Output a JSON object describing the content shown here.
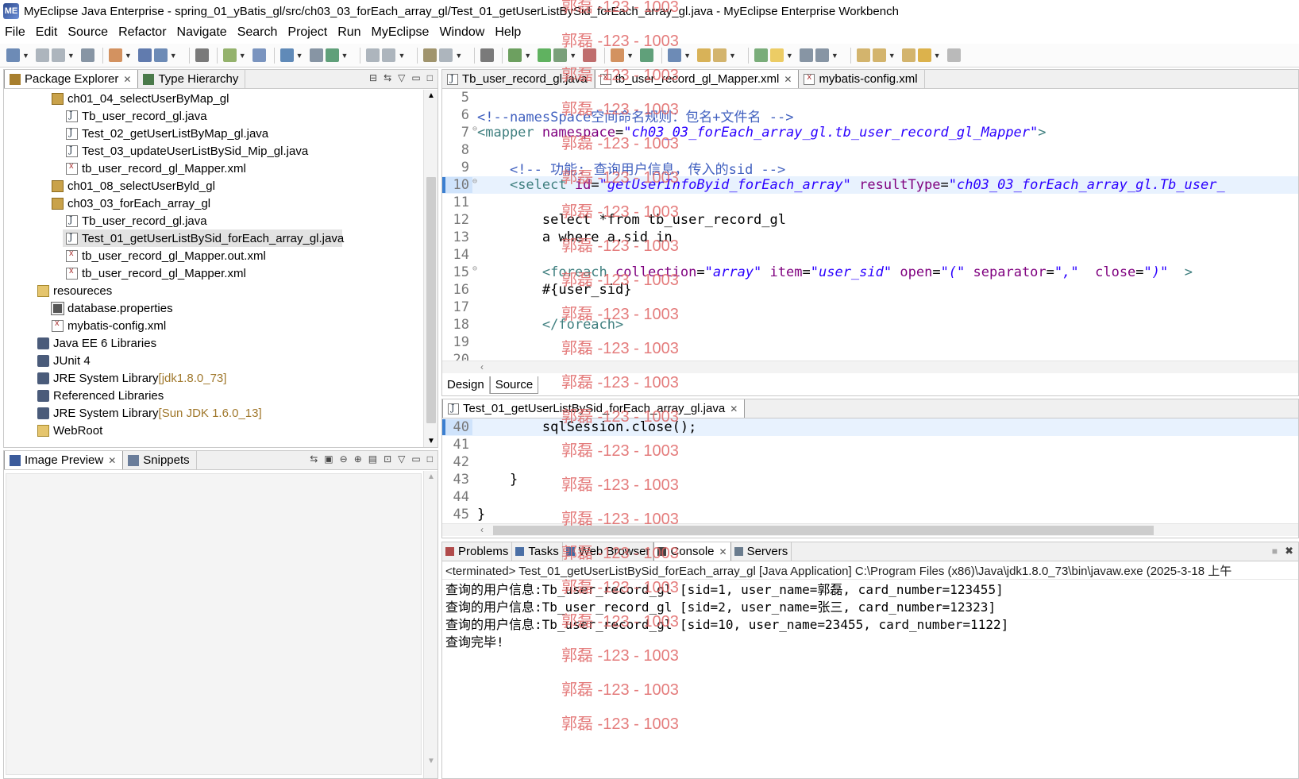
{
  "window": {
    "title": "MyEclipse Java Enterprise - spring_01_yBatis_gl/src/ch03_03_forEach_array_gl/Test_01_getUserListBySid_forEach_array_gl.java - MyEclipse Enterprise Workbench"
  },
  "menu": [
    "File",
    "Edit",
    "Source",
    "Refactor",
    "Navigate",
    "Search",
    "Project",
    "Run",
    "MyEclipse",
    "Window",
    "Help"
  ],
  "package_explorer": {
    "tabs": [
      "Package Explorer",
      "Type Hierarchy"
    ],
    "items": [
      {
        "label": "ch01_04_selectUserByMap_gl",
        "type": "pkg",
        "indent": 3
      },
      {
        "label": "Tb_user_record_gl.java",
        "type": "java",
        "indent": 4
      },
      {
        "label": "Test_02_getUserListByMap_gl.java",
        "type": "java",
        "indent": 4
      },
      {
        "label": "Test_03_updateUserListBySid_Mip_gl.java",
        "type": "java",
        "indent": 4
      },
      {
        "label": "tb_user_record_gl_Mapper.xml",
        "type": "xml",
        "indent": 4
      },
      {
        "label": "ch01_08_selectUserByld_gl",
        "type": "pkg",
        "indent": 3
      },
      {
        "label": "ch03_03_forEach_array_gl",
        "type": "pkg",
        "indent": 3
      },
      {
        "label": "Tb_user_record_gl.java",
        "type": "java",
        "indent": 4
      },
      {
        "label": "Test_01_getUserListBySid_forEach_array_gl.java",
        "type": "java",
        "indent": 4,
        "selected": true
      },
      {
        "label": "tb_user_record_gl_Mapper.out.xml",
        "type": "xml",
        "indent": 4
      },
      {
        "label": "tb_user_record_gl_Mapper.xml",
        "type": "xml",
        "indent": 4
      },
      {
        "label": "resoureces",
        "type": "folder",
        "indent": 2
      },
      {
        "label": "database.properties",
        "type": "props",
        "indent": 3
      },
      {
        "label": "mybatis-config.xml",
        "type": "xml",
        "indent": 3
      },
      {
        "label": "Java EE 6 Libraries",
        "type": "lib",
        "indent": 2
      },
      {
        "label": "JUnit 4",
        "type": "lib",
        "indent": 2
      },
      {
        "label": "JRE System Library",
        "suffix": "[jdk1.8.0_73]",
        "type": "lib",
        "indent": 2
      },
      {
        "label": "Referenced Libraries",
        "type": "lib",
        "indent": 2
      },
      {
        "label": "JRE System Library",
        "suffix": "[Sun JDK 1.6.0_13]",
        "type": "lib",
        "indent": 2
      },
      {
        "label": "WebRoot",
        "type": "folder",
        "indent": 2
      }
    ]
  },
  "image_preview": {
    "tabs": [
      "Image Preview",
      "Snippets"
    ]
  },
  "xml_editor": {
    "tabs": [
      "Tb_user_record_gl.java",
      "tb_user_record_gl_Mapper.xml",
      "mybatis-config.xml"
    ],
    "active_tab": 1,
    "bottom_tabs": [
      "Design",
      "Source"
    ],
    "lines": [
      {
        "n": "5",
        "html": ""
      },
      {
        "n": "6",
        "html": "<span class='cmt'>&lt;!--namesSpace空间命名规则：包名+文件名 --&gt;</span>"
      },
      {
        "n": "7",
        "fold": true,
        "html": "<span class='tag'>&lt;mapper</span> <span class='attr'>namespace</span>=<span class='str'>\"ch03_03_forEach_array_gl.tb_user_record_gl_Mapper\"</span><span class='tag'>&gt;</span>"
      },
      {
        "n": "8",
        "html": ""
      },
      {
        "n": "9",
        "html": "    <span class='cmt'>&lt;!-- 功能: 查询用户信息，传入的sid --&gt;</span>"
      },
      {
        "n": "10",
        "fold": true,
        "cur": true,
        "html": "    <span class='tag'>&lt;select</span> <span class='attr'>id</span>=<span class='str'>\"getUserInfoByid_forEach_array\"</span> <span class='attr'>resultType</span>=<span class='str'>\"ch03_03_forEach_array_gl.Tb_user_</span>"
      },
      {
        "n": "11",
        "html": ""
      },
      {
        "n": "12",
        "html": "        select *from tb_user_record_gl"
      },
      {
        "n": "13",
        "html": "        a where a.sid in"
      },
      {
        "n": "14",
        "html": ""
      },
      {
        "n": "15",
        "fold": true,
        "html": "        <span class='tag'>&lt;foreach</span> <span class='attr'>collection</span>=<span class='str'>\"array\"</span> <span class='attr'>item</span>=<span class='str'>\"user_sid\"</span> <span class='attr'>open</span>=<span class='str'>\"(\"</span> <span class='attr'>separator</span>=<span class='str'>\",\"</span>  <span class='attr'>close</span>=<span class='str'>\")\"</span>  <span class='tag'>&gt;</span>"
      },
      {
        "n": "16",
        "html": "        #{user_sid}"
      },
      {
        "n": "17",
        "html": ""
      },
      {
        "n": "18",
        "html": "        <span class='tag'>&lt;/foreach&gt;</span>"
      },
      {
        "n": "19",
        "html": ""
      },
      {
        "n": "20",
        "html": ""
      }
    ]
  },
  "java_editor": {
    "tab": "Test_01_getUserListBySid_forEach_array_gl.java",
    "lines": [
      {
        "n": "40",
        "cur": true,
        "html": "        sqlSession.close();"
      },
      {
        "n": "41",
        "html": ""
      },
      {
        "n": "42",
        "html": ""
      },
      {
        "n": "43",
        "html": "    }"
      },
      {
        "n": "44",
        "html": ""
      },
      {
        "n": "45",
        "html": "}"
      }
    ]
  },
  "console": {
    "tabs": [
      "Problems",
      "Tasks",
      "Web Browser",
      "Console",
      "Servers"
    ],
    "active_tab": 3,
    "terminated": "<terminated> Test_01_getUserListBySid_forEach_array_gl [Java Application] C:\\Program Files (x86)\\Java\\jdk1.8.0_73\\bin\\javaw.exe (2025-3-18 上午",
    "lines": [
      "查询的用户信息:Tb_user_record_gl [sid=1, user_name=郭磊, card_number=123455]",
      "查询的用户信息:Tb_user_record_gl [sid=2, user_name=张三, card_number=12323]",
      "查询的用户信息:Tb_user_record_gl [sid=10, user_name=23455, card_number=1122]",
      "查询完毕!"
    ]
  },
  "watermark": "郭磊 -123 - 1003",
  "colors": {
    "watermark": "#e06666",
    "keyword": "#7f0055",
    "string": "#2a00ff",
    "comment": "#3f5fbf",
    "tag": "#3f7f7f",
    "attribute": "#7f007f"
  }
}
